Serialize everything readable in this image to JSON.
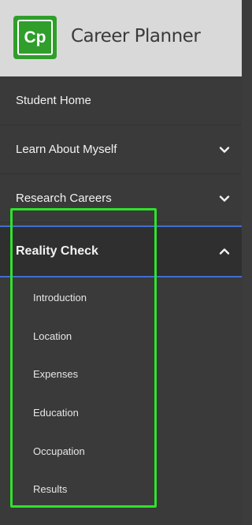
{
  "app": {
    "logo_text": "Cp",
    "title": "Career Planner"
  },
  "nav": {
    "items": [
      {
        "label": "Student Home",
        "chevron": "none"
      },
      {
        "label": "Learn About Myself",
        "chevron": "chevron-down-icon"
      },
      {
        "label": "Research Careers",
        "chevron": "chevron-down-icon"
      },
      {
        "label": "Reality Check",
        "chevron": "chevron-up-icon",
        "expanded": true
      }
    ],
    "reality_check_subitems": [
      {
        "label": "Introduction"
      },
      {
        "label": "Location"
      },
      {
        "label": "Expenses"
      },
      {
        "label": "Education"
      },
      {
        "label": "Occupation"
      },
      {
        "label": "Results"
      }
    ]
  },
  "colors": {
    "brand_green": "#2f9e2b",
    "highlight_green": "#2ee32a",
    "active_border_blue": "#3f6fd1",
    "sidebar_bg": "#3a3a3a"
  }
}
